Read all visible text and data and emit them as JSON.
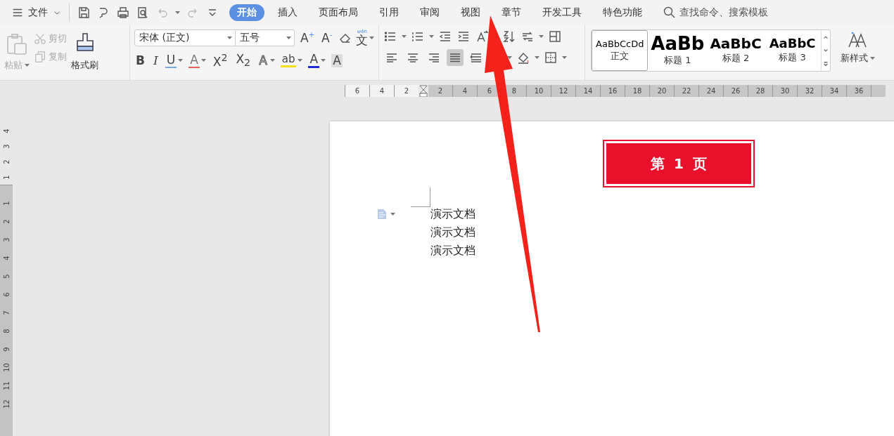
{
  "menu": {
    "label": "文件"
  },
  "tabs": [
    {
      "label": "开始",
      "selected": true
    },
    {
      "label": "插入",
      "selected": false
    },
    {
      "label": "页面布局",
      "selected": false
    },
    {
      "label": "引用",
      "selected": false
    },
    {
      "label": "审阅",
      "selected": false
    },
    {
      "label": "视图",
      "selected": false
    },
    {
      "label": "章节",
      "selected": false
    },
    {
      "label": "开发工具",
      "selected": false
    },
    {
      "label": "特色功能",
      "selected": false
    }
  ],
  "search": {
    "placeholder": "查找命令、搜索模板"
  },
  "clipboard": {
    "paste": {
      "label": "粘贴",
      "disabled": true
    },
    "cut": {
      "label": "剪切",
      "disabled": true
    },
    "copy": {
      "label": "复制",
      "disabled": true
    },
    "format_painter": {
      "label": "格式刷",
      "disabled": false
    }
  },
  "font": {
    "family": "宋体 (正文)",
    "size": "五号"
  },
  "font_tools": [
    {
      "kind": "grow",
      "glyph": "A$^{+}$",
      "dropdown": false
    },
    {
      "kind": "shrink",
      "glyph": "A$^{-}$",
      "dropdown": false
    },
    {
      "kind": "eraser",
      "dropdown": false
    },
    {
      "kind": "phonetic",
      "glyph": "文",
      "ruby": "wén",
      "dropdown": true
    }
  ],
  "font_buttons": [
    {
      "kind": "bold",
      "glyph": "B",
      "dropdown": false
    },
    {
      "kind": "italic",
      "glyph": "I",
      "dropdown": false
    },
    {
      "kind": "underline",
      "glyph": "U",
      "dropdown": true
    },
    {
      "kind": "strike",
      "glyph": "A",
      "dropdown": true
    },
    {
      "kind": "superscript",
      "glyph": "X$^{2}$",
      "dropdown": false
    },
    {
      "kind": "subscript",
      "glyph": "X$_{2}$",
      "dropdown": false
    },
    {
      "kind": "outline",
      "glyph": "A",
      "dropdown": true
    },
    {
      "kind": "highlight",
      "glyph": "ab",
      "dropdown": true
    },
    {
      "kind": "color",
      "glyph": "A",
      "dropdown": true
    },
    {
      "kind": "shade",
      "glyph": "A",
      "dropdown": false
    }
  ],
  "align_buttons": [
    {
      "kind": "left",
      "selected": false
    },
    {
      "kind": "center",
      "selected": false
    },
    {
      "kind": "right",
      "selected": false
    },
    {
      "kind": "justify",
      "selected": true
    },
    {
      "kind": "distributed",
      "selected": false
    }
  ],
  "styles": [
    {
      "kind": "body",
      "preview": "AaBbCcDd",
      "label": "正文",
      "selected": true
    },
    {
      "kind": "heading1",
      "preview": "AaBb",
      "label": "标题 1",
      "selected": false
    },
    {
      "kind": "heading2",
      "preview": "AaBbC",
      "label": "标题 2",
      "selected": false
    },
    {
      "kind": "heading3",
      "preview": "AaBbC",
      "label": "标题 3",
      "selected": false
    }
  ],
  "new_style": {
    "label": "新样式"
  },
  "ruler": {
    "left_labels": [
      "6",
      "4",
      "2"
    ],
    "labels": [
      "2",
      "4",
      "6",
      "8",
      "10",
      "12",
      "14",
      "16",
      "18",
      "20",
      "22",
      "24",
      "26",
      "28",
      "30",
      "32",
      "34",
      "36"
    ]
  },
  "vertical_ruler": {
    "top_labels": [
      "4",
      "3",
      "2",
      "1"
    ],
    "labels": [
      "1",
      "2",
      "3",
      "4",
      "5",
      "6",
      "7",
      "8",
      "9",
      "10",
      "11",
      "12"
    ]
  },
  "document": {
    "page_badge": "第 1 页",
    "lines": [
      "演示文档",
      "演示文档",
      "演示文档"
    ]
  }
}
